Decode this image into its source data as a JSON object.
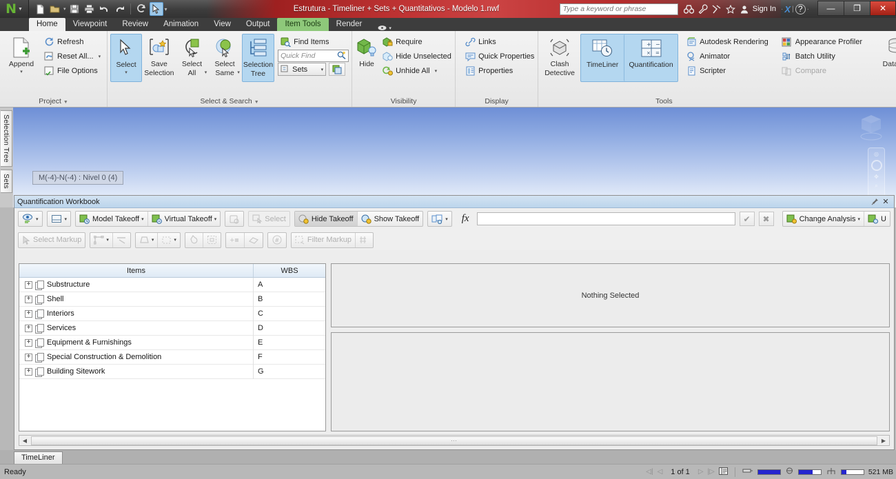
{
  "window": {
    "title": "Estrutura - Timeliner + Sets + Quantitativos - Modelo 1.nwf",
    "minimize": "—",
    "restore": "❐",
    "close": "✕"
  },
  "quick_access": [
    {
      "name": "new-file-icon",
      "glyph": "🗋"
    },
    {
      "name": "open-file-icon",
      "glyph": "🗁"
    },
    {
      "name": "open-dropdown-icon",
      "glyph": "▾"
    },
    {
      "name": "save-icon",
      "glyph": "💾"
    },
    {
      "name": "print-icon",
      "glyph": "🖨"
    },
    {
      "name": "undo-icon",
      "glyph": "↶"
    },
    {
      "name": "redo-icon",
      "glyph": "↷"
    },
    {
      "name": "refresh-icon",
      "glyph": "⟳"
    },
    {
      "name": "select-cursor-icon",
      "glyph": "⬉"
    },
    {
      "name": "qat-dropdown-icon",
      "glyph": "▾"
    }
  ],
  "search": {
    "placeholder": "Type a keyword or phrase",
    "icons": [
      "binoculars-icon",
      "wrench-icon",
      "satellite-icon",
      "star-icon"
    ],
    "sign_in": "Sign In",
    "exchange": "X",
    "help": "?"
  },
  "tabs": [
    {
      "label": "Home",
      "state": "active"
    },
    {
      "label": "Viewpoint",
      "state": "normal"
    },
    {
      "label": "Review",
      "state": "normal"
    },
    {
      "label": "Animation",
      "state": "normal"
    },
    {
      "label": "View",
      "state": "normal"
    },
    {
      "label": "Output",
      "state": "normal"
    },
    {
      "label": "Item Tools",
      "state": "contextual"
    },
    {
      "label": "Render",
      "state": "normal"
    }
  ],
  "ribbon": {
    "project": {
      "title": "Project",
      "append": "Append",
      "items": [
        {
          "label": "Refresh",
          "icon": "refresh-icon",
          "disabled": false,
          "caret": false
        },
        {
          "label": "Reset All...",
          "icon": "reset-all-icon",
          "disabled": false,
          "caret": true
        },
        {
          "label": "File Options",
          "icon": "file-options-icon",
          "disabled": false,
          "caret": false
        }
      ]
    },
    "select_search": {
      "title": "Select & Search",
      "select": "Select",
      "save_selection": "Save\nSelection",
      "save_selection_l1": "Save",
      "save_selection_l2": "Selection",
      "select_all_l1": "Select",
      "select_all_l2": "All",
      "select_same_l1": "Select",
      "select_same_l2": "Same",
      "selection_tree_l1": "Selection",
      "selection_tree_l2": "Tree",
      "find_items": "Find Items",
      "quick_find_placeholder": "Quick Find",
      "sets": "Sets"
    },
    "visibility": {
      "title": "Visibility",
      "hide": "Hide",
      "items": [
        {
          "label": "Require",
          "icon": "require-lock-icon",
          "caret": false
        },
        {
          "label": "Hide Unselected",
          "icon": "hide-unselected-icon",
          "caret": false
        },
        {
          "label": "Unhide All",
          "icon": "unhide-all-icon",
          "caret": true
        }
      ]
    },
    "display": {
      "title": "Display",
      "items": [
        {
          "label": "Links",
          "icon": "links-icon"
        },
        {
          "label": "Quick Properties",
          "icon": "quick-properties-icon"
        },
        {
          "label": "Properties",
          "icon": "properties-icon"
        }
      ]
    },
    "tools": {
      "title": "Tools",
      "clash_l1": "Clash",
      "clash_l2": "Detective",
      "timeliner": "TimeLiner",
      "quantification": "Quantification",
      "datatools": "DataTools",
      "items": [
        {
          "label": "Autodesk Rendering",
          "icon": "autodesk-rendering-icon",
          "disabled": false
        },
        {
          "label": "Animator",
          "icon": "animator-icon",
          "disabled": false
        },
        {
          "label": "Scripter",
          "icon": "scripter-icon",
          "disabled": false
        },
        {
          "label": "Appearance Profiler",
          "icon": "appearance-profiler-icon",
          "disabled": false
        },
        {
          "label": "Batch Utility",
          "icon": "batch-utility-icon",
          "disabled": false
        },
        {
          "label": "Compare",
          "icon": "compare-icon",
          "disabled": true
        }
      ]
    }
  },
  "view": {
    "side_tabs": [
      "Selection Tree",
      "Sets"
    ],
    "tooltip": "M(-4)-N(-4) : Nivel 0 (4)",
    "colors": {
      "roof": "#f7b96a",
      "wall": "#f5c3b0",
      "wall_shadow": "#e8a693",
      "slab": "#1c35c9",
      "sky_top": "#6e8fd6",
      "sky_bottom": "#eef3fc"
    }
  },
  "workbook": {
    "title": "Quantification Workbook",
    "pin_icon": "pin-icon",
    "close_icon": "close-icon",
    "toolbar_row1": [
      {
        "name": "view-mode-button",
        "label": "",
        "icon": "eye-icon",
        "caret": true,
        "disabled": false
      },
      {
        "name": "layout-button",
        "label": "",
        "icon": "panel-icon",
        "caret": true,
        "disabled": false
      },
      {
        "name": "model-takeoff-button",
        "label": "Model Takeoff",
        "icon": "model-takeoff-icon",
        "caret": true,
        "disabled": false
      },
      {
        "name": "virtual-takeoff-button",
        "label": "Virtual Takeoff",
        "icon": "virtual-takeoff-icon",
        "caret": true,
        "disabled": false
      },
      {
        "name": "takeoff-extra-button",
        "label": "",
        "icon": "takeoff-copy-icon",
        "caret": false,
        "disabled": true
      },
      {
        "name": "select-button",
        "label": "Select",
        "icon": "select-icon",
        "caret": false,
        "disabled": true
      },
      {
        "name": "hide-takeoff-button",
        "label": "Hide Takeoff",
        "icon": "hide-takeoff-icon",
        "caret": false,
        "disabled": false
      },
      {
        "name": "show-takeoff-button",
        "label": "Show Takeoff",
        "icon": "show-takeoff-icon",
        "caret": false,
        "disabled": false
      },
      {
        "name": "takeoff-options-button",
        "label": "",
        "icon": "takeoff-options-icon",
        "caret": true,
        "disabled": false
      }
    ],
    "formula_label": "fx",
    "formula_value": "",
    "accept_icon": "check-icon",
    "cancel_icon": "cross-icon",
    "change_analysis": "Change Analysis",
    "update_button": "U",
    "toolbar_row2": [
      {
        "name": "select-markup-button",
        "label": "Select Markup",
        "icon": "arrow-icon",
        "caret": false,
        "disabled": true
      },
      {
        "name": "markup-line-button",
        "label": "",
        "icon": "markup-line-icon",
        "caret": true,
        "disabled": true
      },
      {
        "name": "markup-measure-button",
        "label": "",
        "icon": "markup-measure-icon",
        "caret": false,
        "disabled": true
      },
      {
        "name": "markup-area-button",
        "label": "",
        "icon": "markup-area-icon",
        "caret": true,
        "disabled": true
      },
      {
        "name": "markup-region-button",
        "label": "",
        "icon": "markup-region-icon",
        "caret": true,
        "disabled": true
      },
      {
        "name": "markup-paint-button",
        "label": "",
        "icon": "paint-icon",
        "caret": false,
        "disabled": true
      },
      {
        "name": "markup-select-region-button",
        "label": "",
        "icon": "select-region-icon",
        "caret": false,
        "disabled": true
      },
      {
        "name": "markup-add-button",
        "label": "",
        "icon": "add-item-icon",
        "caret": false,
        "disabled": true
      },
      {
        "name": "markup-erase-button",
        "label": "",
        "icon": "eraser-icon",
        "caret": false,
        "disabled": true
      },
      {
        "name": "markup-count-button",
        "label": "",
        "icon": "count-icon",
        "caret": false,
        "disabled": true
      },
      {
        "name": "filter-markup-button",
        "label": "Filter Markup",
        "icon": "filter-markup-icon",
        "caret": false,
        "disabled": true
      },
      {
        "name": "markup-settings-button",
        "label": "",
        "icon": "markup-settings-icon",
        "caret": false,
        "disabled": true
      }
    ],
    "grid": {
      "columns": [
        "Items",
        "WBS"
      ],
      "rows": [
        {
          "item": "Substructure",
          "wbs": "A"
        },
        {
          "item": "Shell",
          "wbs": "B"
        },
        {
          "item": "Interiors",
          "wbs": "C"
        },
        {
          "item": "Services",
          "wbs": "D"
        },
        {
          "item": "Equipment & Furnishings",
          "wbs": "E"
        },
        {
          "item": "Special Construction & Demolition",
          "wbs": "F"
        },
        {
          "item": "Building Sitework",
          "wbs": "G"
        }
      ]
    },
    "properties_empty": "Nothing Selected"
  },
  "bottom_tabs": [
    {
      "label": "TimeLiner",
      "active": true
    }
  ],
  "status": {
    "ready": "Ready",
    "page": "1 of 1",
    "memory": "521 MB",
    "meters": [
      100,
      62,
      24
    ]
  }
}
